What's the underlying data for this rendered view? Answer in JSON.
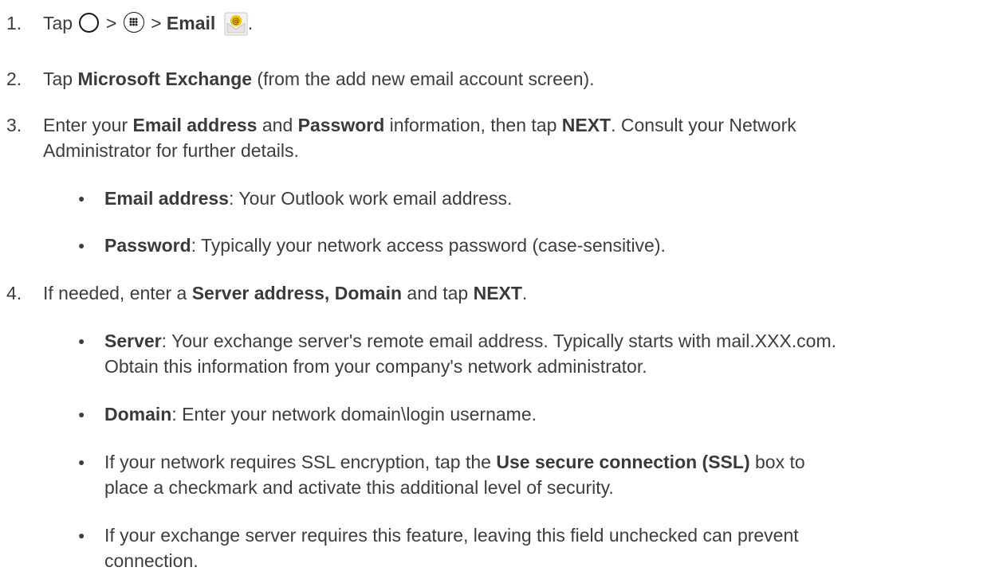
{
  "steps": [
    {
      "number": "1.",
      "parts": {
        "tap": "Tap",
        "sep1": ">",
        "sep2": ">",
        "app": "Email",
        "end": "."
      },
      "icons": [
        "home-circle-icon",
        "apps-icon",
        "email-app-icon"
      ]
    },
    {
      "number": "2.",
      "parts": {
        "a": "Tap ",
        "b": "Microsoft Exchange",
        "c": " (from the add new email account screen)."
      }
    },
    {
      "number": "3.",
      "parts": {
        "a": "Enter your ",
        "b": "Email address",
        "c": " and ",
        "d": "Password",
        "e": " information, then tap ",
        "f": "NEXT",
        "g": ". Consult your Network",
        "line2": "Administrator for further details."
      },
      "bullets": [
        {
          "term": "Email address",
          "desc": ": Your Outlook work email address."
        },
        {
          "term": "Password",
          "desc": ": Typically your network access password (case-sensitive)."
        }
      ]
    },
    {
      "number": "4.",
      "parts": {
        "a": "If needed, enter a ",
        "b": "Server address, Domain",
        "c": " and tap ",
        "d": "NEXT",
        "e": "."
      },
      "bullets": [
        {
          "term": "Server",
          "desc": ": Your exchange server's remote email address. Typically starts with mail.XXX.com.",
          "line2": "Obtain this information from your company's network administrator."
        },
        {
          "term": "Domain",
          "desc": ": Enter your network domain\\login username."
        },
        {
          "pre": "If your network requires SSL encryption, tap the ",
          "term": "Use secure connection (SSL)",
          "post": " box to",
          "line2": "place a checkmark and activate this additional level of security."
        },
        {
          "pre": "If your exchange server requires this feature, leaving this field unchecked can prevent",
          "line2": "connection."
        }
      ]
    }
  ],
  "bullet_glyph": "●",
  "colors": {
    "text": "#3d3d3d",
    "email_icon_yellow": "#f5c400",
    "email_icon_envelope": "#e9e9e9"
  }
}
